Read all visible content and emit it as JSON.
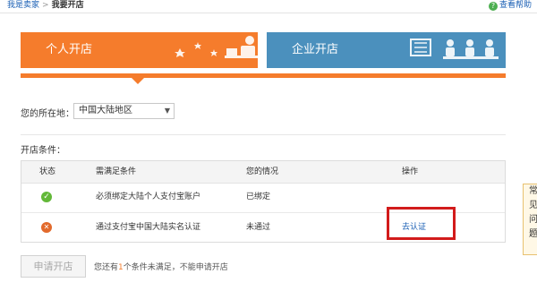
{
  "breadcrumb": {
    "home": "我是卖家",
    "separator": ">",
    "current": "我要开店"
  },
  "help": {
    "label": "查看帮助"
  },
  "tabs": [
    {
      "label": "个人开店",
      "active": true,
      "color": "#f57c2c"
    },
    {
      "label": "企业开店",
      "active": false,
      "color": "#4b90bd"
    }
  ],
  "location": {
    "label": "您的所在地：",
    "selected": "中国大陆地区"
  },
  "conditions": {
    "label": "开店条件：",
    "headers": [
      "状态",
      "需满足条件",
      "您的情况",
      "操作"
    ],
    "rows": [
      {
        "status_icon": "check-icon",
        "requirement": "必须绑定大陆个人支付宝账户",
        "situation": "已绑定",
        "action": ""
      },
      {
        "status_icon": "cross-icon",
        "requirement": "通过支付宝中国大陆实名认证",
        "situation": "未通过",
        "action": "去认证"
      }
    ]
  },
  "apply": {
    "button_label": "申请开店",
    "note_prefix": "您还有",
    "note_count": "1",
    "note_suffix": "个条件未满足，不能申请开店"
  },
  "side_widget": {
    "text": "常见问题"
  },
  "colors": {
    "accent": "#f57c2c",
    "secondary": "#4b90bd",
    "link": "#1a5fb4",
    "highlight": "#d21b1b"
  }
}
